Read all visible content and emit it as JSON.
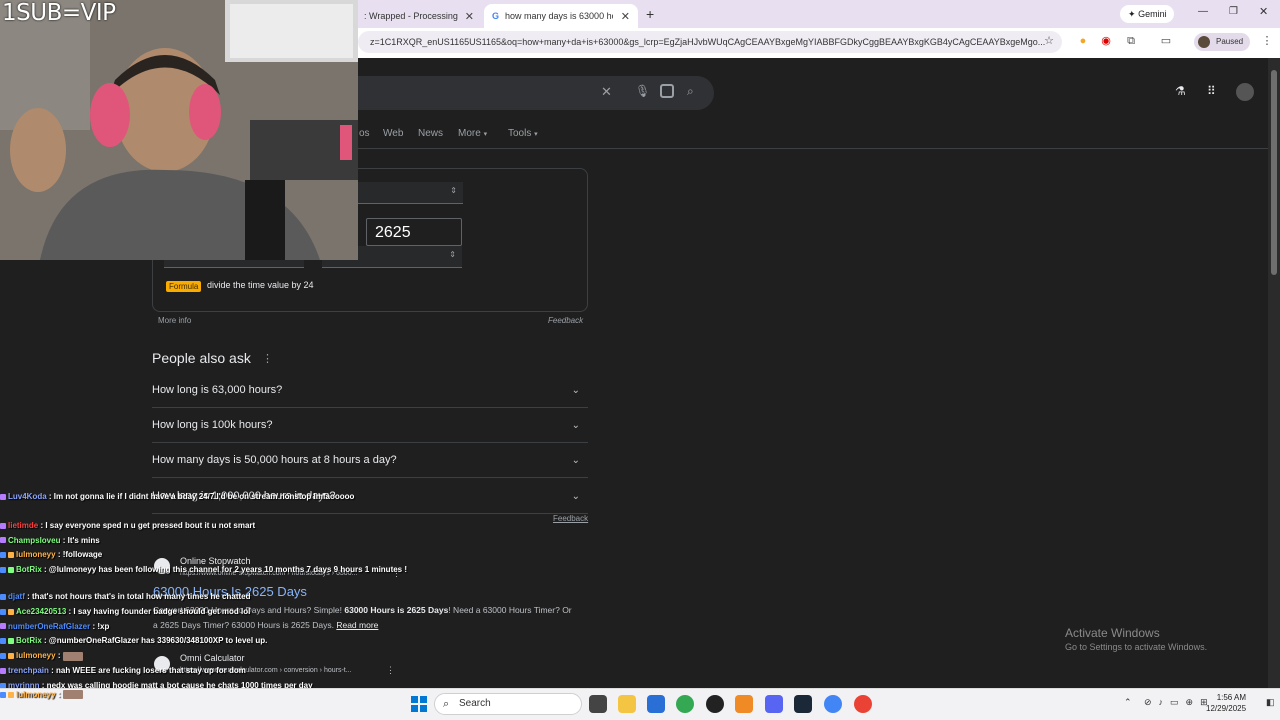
{
  "overlay": {
    "vip_text": "1SUB=VIP"
  },
  "browser": {
    "tabs": [
      {
        "label": ": Wrapped - Processing"
      },
      {
        "label": "how many days is 63000 hours"
      }
    ],
    "new_tab": "+",
    "gemini_label": "Gemini",
    "profile_status": "Paused",
    "omnibox_text": "z=1C1RXQR_enUS1165US1165&oq=how+many+da+is+63000&gs_lcrp=EgZjaHJvbWUqCAgCEAAYBxgeMgYIABBFGDkyCggBEAAYBxgKGB4yCAgCEAAYBxgeMgo..."
  },
  "search": {
    "tabs_partial": "os",
    "tabs": [
      "Web",
      "News",
      "More",
      "Tools"
    ]
  },
  "converter": {
    "result_value": "2625",
    "formula_badge": "Formula",
    "formula_text": "divide the time value by 24",
    "more_info": "More info",
    "feedback": "Feedback"
  },
  "paa": {
    "title": "People also ask",
    "questions": [
      "How long is 63,000 hours?",
      "How long is 100k hours?",
      "How many days is 50,000 hours at 8 hours a day?",
      "How long is 1,000,000 hours in days?"
    ],
    "feedback": "Feedback"
  },
  "results": [
    {
      "source": "Online Stopwatch",
      "url": "https://www.online-stopwatch.com › hourstodays › 6300...",
      "title": "63000 Hours Is 2625 Days",
      "snippet_pre": "Convert 63000 Hours to Days and Hours? Simple! ",
      "snippet_bold": "63000 Hours is 2625 Days",
      "snippet_post": "! Need a 63000 Hours Timer? Or a 2625 Days Timer? 63000 Hours is 2625 Days.",
      "read_more": "Read more"
    },
    {
      "source": "Omni Calculator",
      "url": "https://www.omnicalculator.com › conversion › hours-t..."
    }
  ],
  "windows_watermark": {
    "line1": "Activate Windows",
    "line2": "Go to Settings to activate Windows."
  },
  "chat": [
    {
      "name": "Luv4Koda",
      "color": "#8aa4ff",
      "msg": ": Im not gonna lie if I didnt have a bday 24/7 I'd be on stream nonstop lmfaooooo"
    },
    {
      "name": "lietimde",
      "color": "#ff4040",
      "msg": ": I say everyone sped n u get pressed bout it u not smart"
    },
    {
      "name": "Champsloveu",
      "color": "#7fff7f",
      "msg": ": It's mins"
    },
    {
      "name": "lulmoneyy",
      "color": "#ffb347",
      "msg": ": !followage"
    },
    {
      "name": "BotRix",
      "color": "#7fff7f",
      "msg": ": @lulmoneyy has been following this channel for 2 years 10 months 7 days 9 hours 1 minutes !"
    },
    {
      "name": "djatf",
      "color": "#4d8cff",
      "msg": ": that's not hours that's in total how many times he chatted"
    },
    {
      "name": "Ace23420513",
      "color": "#7fff7f",
      "msg": ": I say having founder badge should get mod lol"
    },
    {
      "name": "numberOneRafGlazer",
      "color": "#4d8cff",
      "msg": ": !xp"
    },
    {
      "name": "BotRix",
      "color": "#7fff7f",
      "msg": ": @numberOneRafGlazer has 339630/348100XP to level up."
    },
    {
      "name": "lulmoneyy",
      "color": "#ffb347",
      "msg": ":"
    },
    {
      "name": "trenchpain",
      "color": "#8aa4ff",
      "msg": ": nah WEEE are fucking losers that stay up for dom"
    },
    {
      "name": "myrinnn",
      "color": "#8aa4ff",
      "msg": ": nedx was calling hoodie matt a bot cause he chats 1000 times per day"
    },
    {
      "name": "lulmoneyy",
      "color": "#ffb347",
      "msg": ":"
    }
  ],
  "taskbar": {
    "search_placeholder": "Search",
    "time": "1:56 AM",
    "date": "12/29/2025"
  }
}
